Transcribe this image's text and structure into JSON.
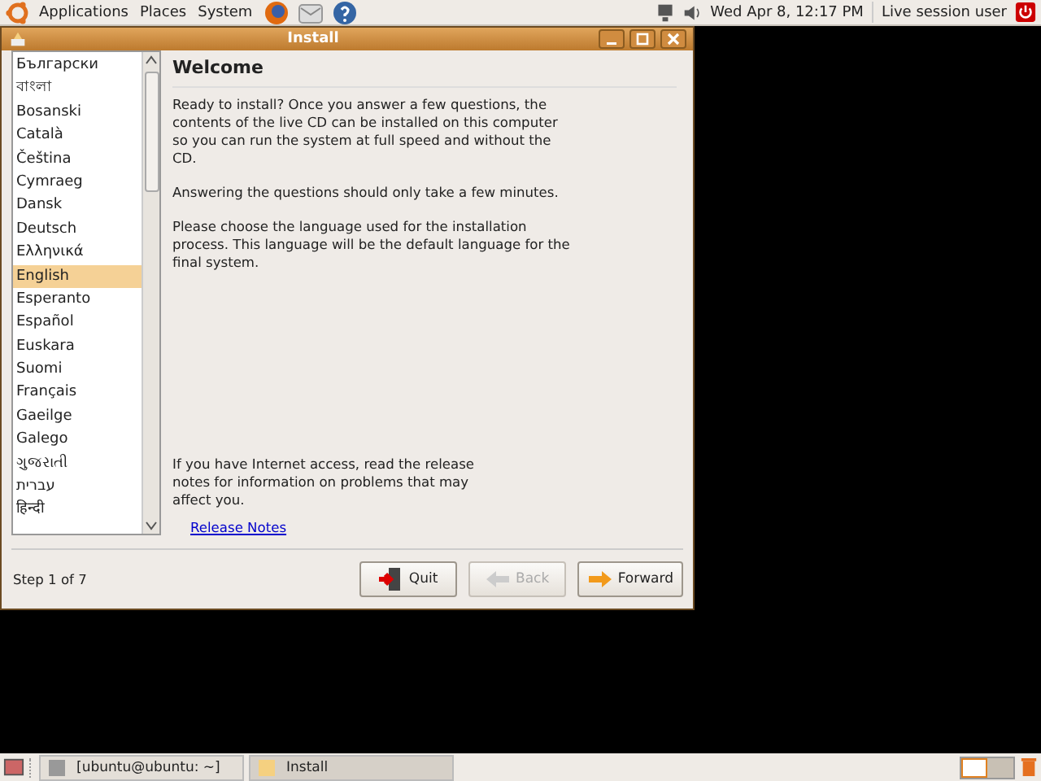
{
  "top_panel": {
    "menus": [
      "Applications",
      "Places",
      "System"
    ],
    "clock": "Wed Apr  8, 12:17 PM",
    "user": "Live session user"
  },
  "window": {
    "title": "Install"
  },
  "languages": [
    {
      "label": "Български",
      "selected": false
    },
    {
      "label": "বাংলা",
      "selected": false
    },
    {
      "label": "Bosanski",
      "selected": false
    },
    {
      "label": "Català",
      "selected": false
    },
    {
      "label": "Čeština",
      "selected": false
    },
    {
      "label": "Cymraeg",
      "selected": false
    },
    {
      "label": "Dansk",
      "selected": false
    },
    {
      "label": "Deutsch",
      "selected": false
    },
    {
      "label": "Ελληνικά",
      "selected": false
    },
    {
      "label": "English",
      "selected": true
    },
    {
      "label": "Esperanto",
      "selected": false
    },
    {
      "label": "Español",
      "selected": false
    },
    {
      "label": "Euskara",
      "selected": false
    },
    {
      "label": "Suomi",
      "selected": false
    },
    {
      "label": "Français",
      "selected": false
    },
    {
      "label": "Gaeilge",
      "selected": false
    },
    {
      "label": "Galego",
      "selected": false
    },
    {
      "label": "ગુજરાતી",
      "selected": false
    },
    {
      "label": "עברית",
      "selected": false
    },
    {
      "label": "हिन्दी",
      "selected": false
    }
  ],
  "heading": "Welcome",
  "paragraphs": [
    "Ready to install? Once you answer a few questions, the contents of the live CD can be installed on this computer so you can run the system at full speed and without the CD.",
    "Answering the questions should only take a few minutes.",
    "Please choose the language used for the installation process. This language will be the default language for the final system."
  ],
  "release_text": "If you have Internet access, read the release notes for information on problems that may affect you.",
  "release_link": "Release Notes",
  "step": "Step 1 of 7",
  "buttons": [
    {
      "kind": "quit",
      "label": "Quit",
      "disabled": false
    },
    {
      "kind": "back",
      "label": "Back",
      "disabled": true
    },
    {
      "kind": "forward",
      "label": "Forward",
      "disabled": false
    }
  ],
  "taskbar": [
    {
      "label": "[ubuntu@ubuntu: ~]",
      "selected": false
    },
    {
      "label": "Install",
      "selected": true
    }
  ]
}
